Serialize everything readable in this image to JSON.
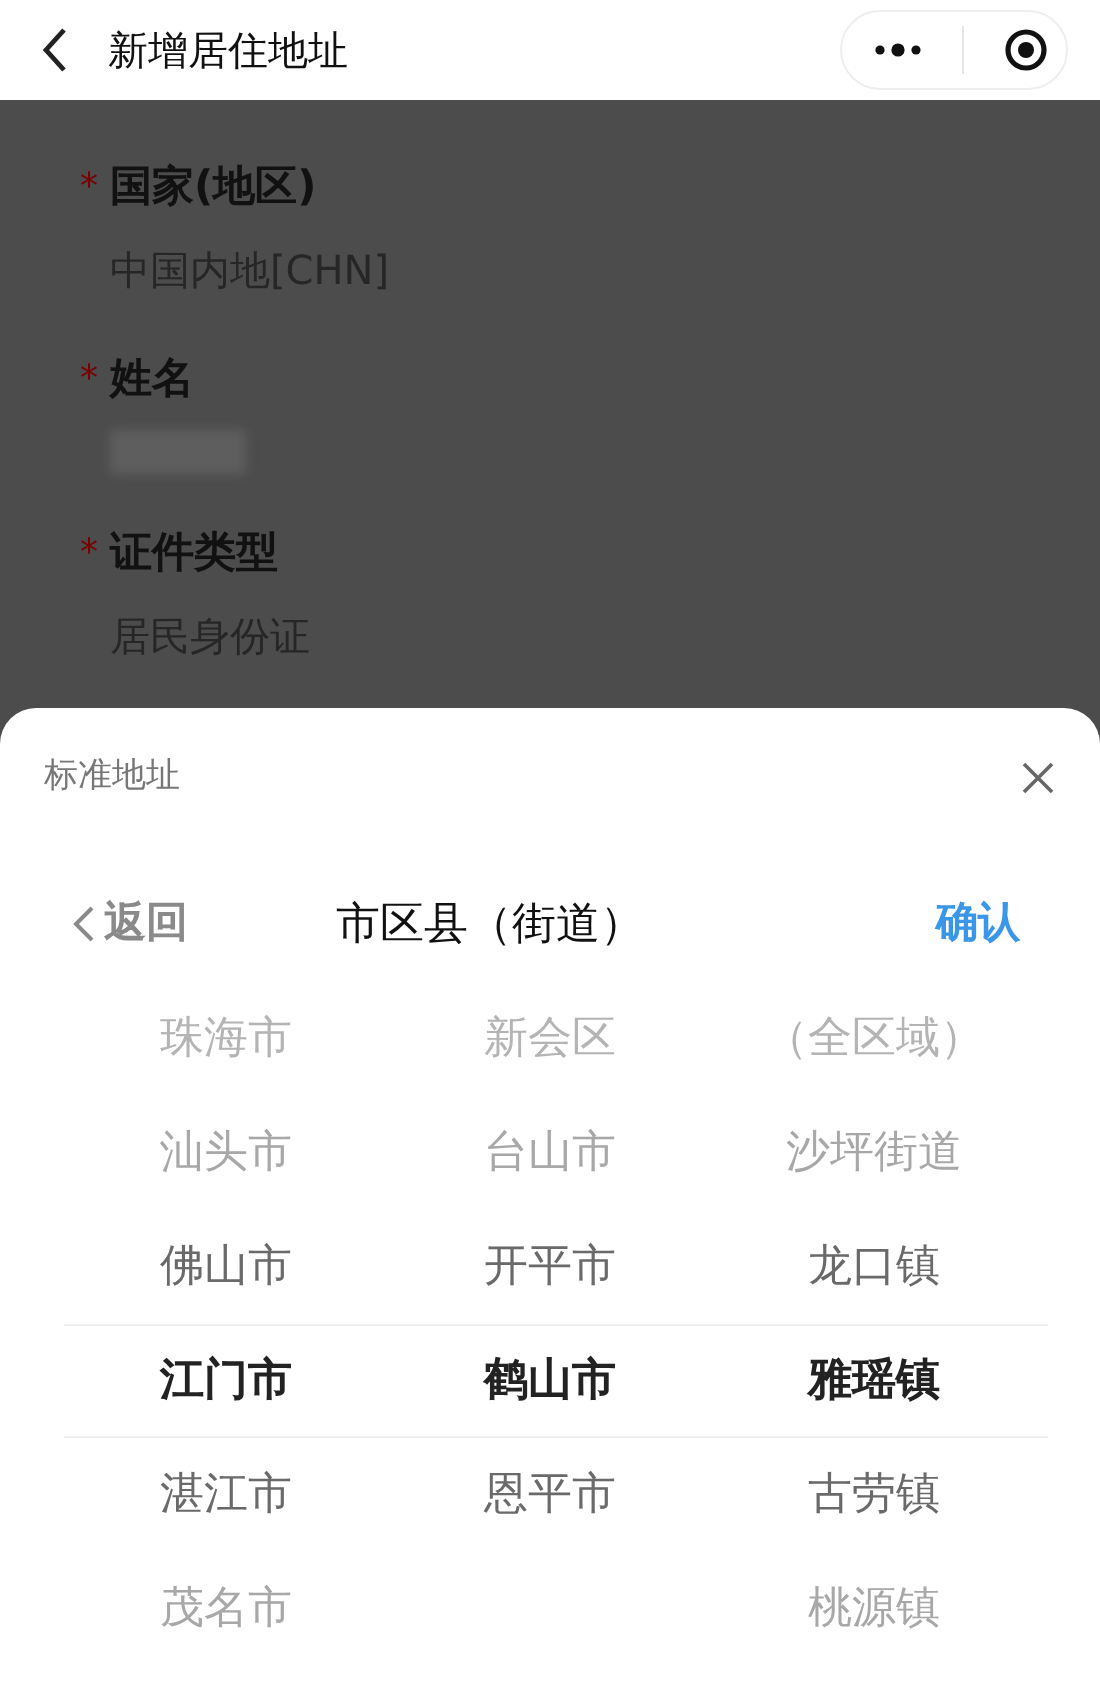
{
  "header": {
    "title": "新增居住地址"
  },
  "form": {
    "fields": [
      {
        "kind": "text",
        "mark": "*",
        "label": "国家(地区)",
        "value": "中国内地[CHN]"
      },
      {
        "kind": "redacted",
        "mark": "*",
        "label": "姓名"
      },
      {
        "kind": "text",
        "mark": "*",
        "label": "证件类型",
        "value": "居民身份证"
      }
    ]
  },
  "sheet": {
    "title": "标准地址",
    "back": "返回",
    "heading": "市区县（街道）",
    "confirm": "确认",
    "columns": [
      {
        "items": [
          {
            "label": "珠海市",
            "selected": false
          },
          {
            "label": "汕头市",
            "selected": false
          },
          {
            "label": "佛山市",
            "selected": false
          },
          {
            "label": "江门市",
            "selected": true
          },
          {
            "label": "湛江市",
            "selected": false
          },
          {
            "label": "茂名市",
            "selected": false
          }
        ]
      },
      {
        "items": [
          {
            "label": "新会区",
            "selected": false
          },
          {
            "label": "台山市",
            "selected": false
          },
          {
            "label": "开平市",
            "selected": false
          },
          {
            "label": "鹤山市",
            "selected": true
          },
          {
            "label": "恩平市",
            "selected": false
          }
        ]
      },
      {
        "items": [
          {
            "label": "（全区域）",
            "selected": false
          },
          {
            "label": "沙坪街道",
            "selected": false
          },
          {
            "label": "龙口镇",
            "selected": false
          },
          {
            "label": "雅瑶镇",
            "selected": true
          },
          {
            "label": "古劳镇",
            "selected": false
          },
          {
            "label": "桃源镇",
            "selected": false
          }
        ]
      }
    ]
  }
}
